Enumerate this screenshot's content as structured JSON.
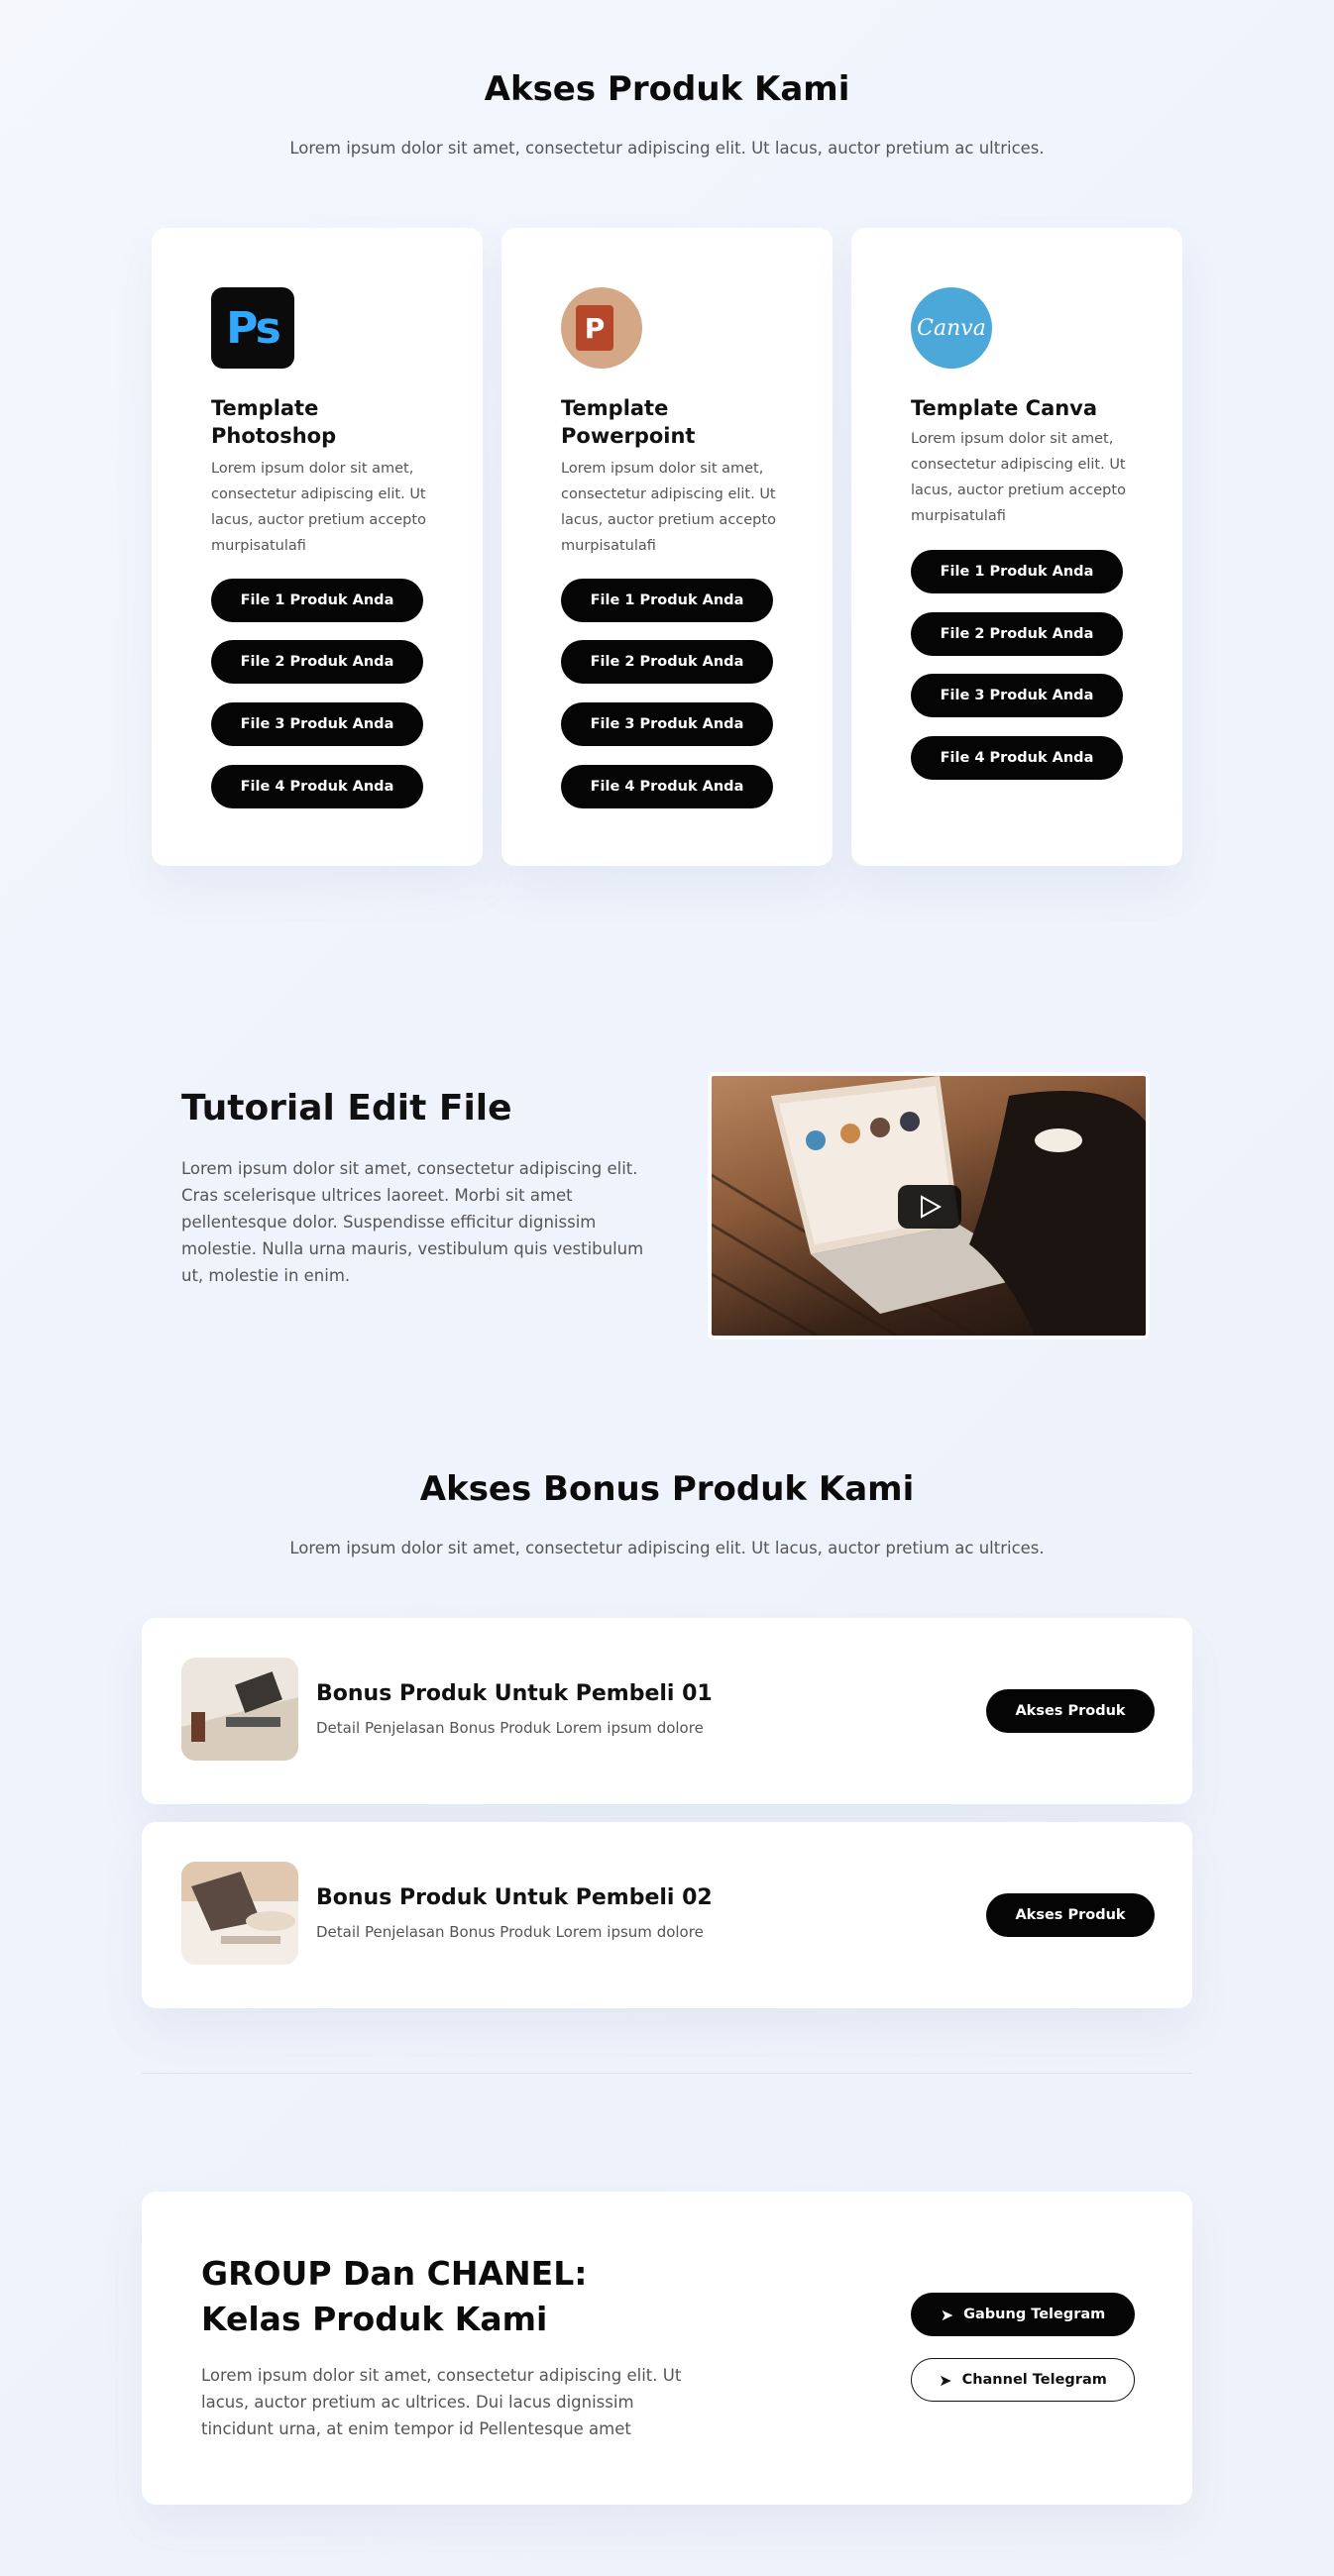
{
  "products_section": {
    "title": "Akses Produk Kami",
    "subtitle": "Lorem ipsum dolor sit amet, consectetur adipiscing elit. Ut lacus, auctor pretium ac ultrices."
  },
  "products": [
    {
      "icon": "photoshop-icon",
      "icon_text": "Ps",
      "title": "Template Photoshop",
      "description": "Lorem ipsum dolor sit amet, consectetur adipiscing elit. Ut lacus, auctor pretium accepto murpisatulafi",
      "buttons": [
        "File 1 Produk Anda",
        "File 2 Produk Anda",
        "File 3 Produk Anda",
        "File 4 Produk Anda"
      ]
    },
    {
      "icon": "powerpoint-icon",
      "icon_text": "P",
      "title": "Template Powerpoint",
      "description": "Lorem ipsum dolor sit amet, consectetur adipiscing elit. Ut lacus, auctor pretium accepto murpisatulafi",
      "buttons": [
        "File 1 Produk Anda",
        "File 2 Produk Anda",
        "File 3 Produk Anda",
        "File 4 Produk Anda"
      ]
    },
    {
      "icon": "canva-icon",
      "icon_text": "Canva",
      "title": "Template Canva",
      "description": "Lorem ipsum dolor sit amet, consectetur adipiscing elit. Ut lacus, auctor pretium accepto murpisatulafi",
      "buttons": [
        "File 1 Produk Anda",
        "File 2 Produk Anda",
        "File 3 Produk Anda",
        "File 4 Produk Anda"
      ]
    }
  ],
  "tutorial": {
    "title": "Tutorial Edit File",
    "description": "Lorem ipsum dolor sit amet, consectetur adipiscing elit. Cras scelerisque ultrices laoreet. Morbi sit amet pellentesque dolor. Suspendisse efficitur dignissim molestie. Nulla urna mauris, vestibulum quis vestibulum ut, molestie in enim."
  },
  "bonus_section": {
    "title": "Akses Bonus Produk Kami",
    "subtitle": "Lorem ipsum dolor sit amet, consectetur adipiscing elit. Ut lacus, auctor pretium ac ultrices."
  },
  "bonuses": [
    {
      "title": "Bonus Produk Untuk Pembeli 01",
      "description": "Detail Penjelasan Bonus Produk Lorem ipsum dolore",
      "button": "Akses Produk"
    },
    {
      "title": "Bonus Produk Untuk Pembeli 02",
      "description": "Detail Penjelasan Bonus Produk Lorem ipsum dolore",
      "button": "Akses Produk"
    }
  ],
  "group": {
    "title_line1": "GROUP Dan CHANEL:",
    "title_line2": "Kelas Produk Kami",
    "description": "Lorem ipsum dolor sit amet, consectetur adipiscing elit. Ut lacus, auctor pretium ac ultrices. Dui lacus dignissim tincidunt urna, at enim tempor id Pellentesque amet",
    "join_button": "Gabung Telegram",
    "channel_button": "Channel Telegram"
  },
  "colors": {
    "button_bg": "#050505",
    "photoshop_blue": "#31a8ff",
    "powerpoint_orange": "#b7472a",
    "canva_blue": "#4ba8d9"
  }
}
